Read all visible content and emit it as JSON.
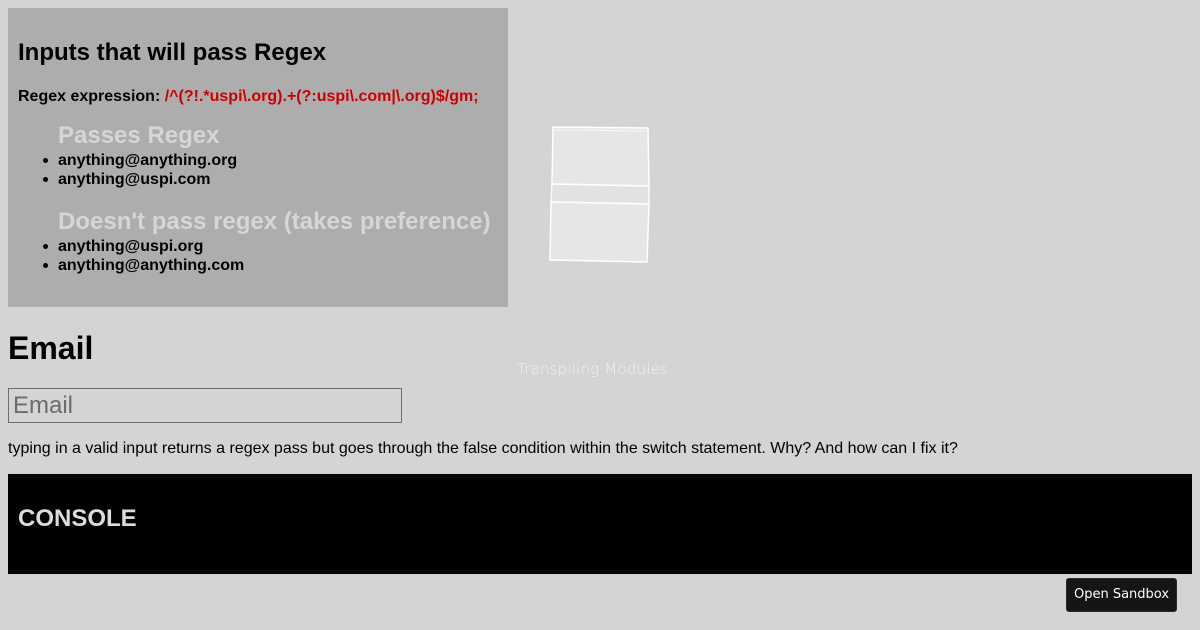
{
  "panel": {
    "title": "Inputs that will pass Regex",
    "regex_label": "Regex expression:",
    "regex_value": "/^(?!.*uspi\\.org).+(?:uspi\\.com|\\.org)$/gm;",
    "passes_heading": "Passes Regex",
    "passes_items": [
      "anything@anything.org",
      "anything@uspi.com"
    ],
    "fails_heading": "Doesn't pass regex (takes preference)",
    "fails_items": [
      "anything@uspi.org",
      "anything@anything.com"
    ]
  },
  "loader": {
    "icon": "cube-icon",
    "text": "Transpiling Modules..."
  },
  "email": {
    "title": "Email",
    "placeholder": "Email",
    "value": ""
  },
  "question": "typing in a valid input returns a regex pass but goes through the false condition within the switch statement. Why? And how can I fix it?",
  "console": {
    "title": "CONSOLE"
  },
  "actions": {
    "open_sandbox": "Open Sandbox"
  },
  "colors": {
    "background": "#d4d4d4",
    "panel_background": "#adadad",
    "regex_code": "#cc0000",
    "console_background": "#000000",
    "button_background": "#151515"
  }
}
